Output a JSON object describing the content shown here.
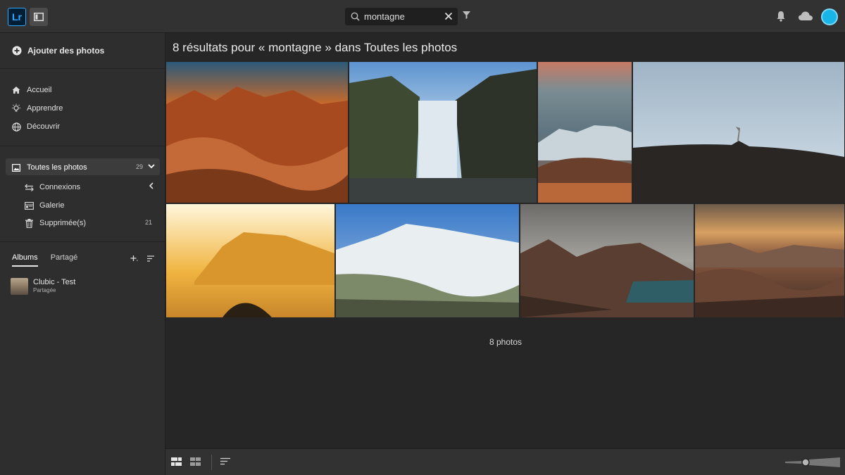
{
  "app": {
    "logo_text": "Lr"
  },
  "search": {
    "value": "montagne"
  },
  "sidebar": {
    "add_photos": "Ajouter des photos",
    "nav": [
      {
        "label": "Accueil",
        "icon": "home-icon"
      },
      {
        "label": "Apprendre",
        "icon": "lightbulb-icon"
      },
      {
        "label": "Découvrir",
        "icon": "globe-icon"
      }
    ],
    "library": {
      "all_photos": {
        "label": "Toutes les photos",
        "count": "29"
      },
      "connections": {
        "label": "Connexions"
      },
      "gallery": {
        "label": "Galerie"
      },
      "deleted": {
        "label": "Supprimée(s)",
        "count": "21"
      }
    },
    "tabs": {
      "albums": "Albums",
      "shared": "Partagé"
    },
    "albums": [
      {
        "name": "Clubic - Test",
        "subtitle": "Partagée"
      }
    ]
  },
  "main": {
    "title": "8 résultats pour « montagne » dans Toutes les photos",
    "footer_count": "8 photos"
  },
  "photos": [
    {
      "name": "desert-rock-sunset",
      "colors": [
        "#2b5a7a",
        "#c96a2a",
        "#a84a20",
        "#6b3218"
      ]
    },
    {
      "name": "waterfall-cliffs",
      "colors": [
        "#6fa4d8",
        "#3f4a32",
        "#dfe8ee",
        "#2d3328"
      ]
    },
    {
      "name": "mountain-dunes",
      "colors": [
        "#7b8d93",
        "#c9d3da",
        "#8a5a40",
        "#b9683a"
      ]
    },
    {
      "name": "volcano-plain",
      "colors": [
        "#c8d6e2",
        "#9fb4c6",
        "#2a2624",
        "#1d1b1a"
      ]
    },
    {
      "name": "golden-lake-sunset",
      "colors": [
        "#fff2cf",
        "#f0b440",
        "#c8862a",
        "#2a2014"
      ]
    },
    {
      "name": "snowy-hill",
      "colors": [
        "#3a79c8",
        "#e9eef1",
        "#7d8a6a",
        "#4c5440"
      ]
    },
    {
      "name": "rocky-fjord",
      "colors": [
        "#8a8a86",
        "#5a3e32",
        "#2f5e66",
        "#3a2a22"
      ]
    },
    {
      "name": "canyon-dusk",
      "colors": [
        "#d6a060",
        "#8a5a40",
        "#6b4634",
        "#3c2a22"
      ]
    }
  ],
  "accent": "#31a8ff"
}
